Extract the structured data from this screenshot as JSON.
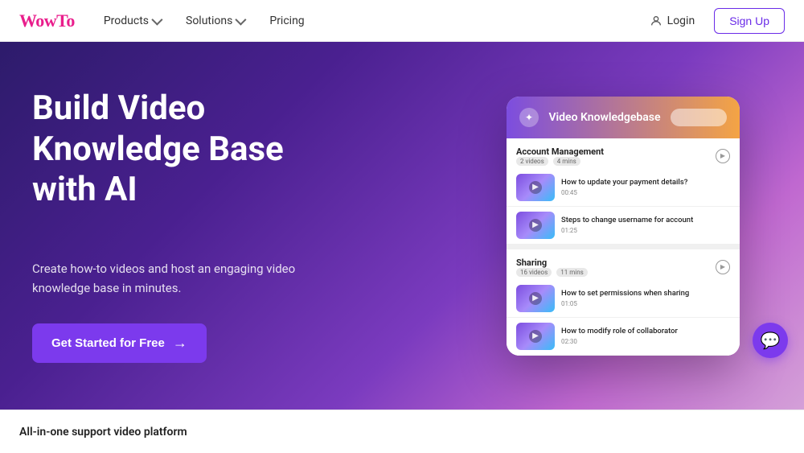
{
  "brand": {
    "logo": "WowTo",
    "logo_color": "#e91e8c"
  },
  "navbar": {
    "links": [
      {
        "label": "Products",
        "has_dropdown": true
      },
      {
        "label": "Solutions",
        "has_dropdown": true
      },
      {
        "label": "Pricing",
        "has_dropdown": false
      }
    ],
    "login_label": "Login",
    "signup_label": "Sign Up"
  },
  "hero": {
    "title": "Build Video Knowledge Base with AI",
    "subtitle": "Create how-to videos and host an engaging video knowledge base in minutes.",
    "cta_label": "Get Started for Free",
    "cta_arrow": "→"
  },
  "mockup": {
    "header_icon": "✦",
    "title": "Video Knowledgebase",
    "sections": [
      {
        "name": "Account Management",
        "badge1": "2 videos",
        "badge2": "4 mins",
        "videos": [
          {
            "title": "How to update your payment details?",
            "duration": "00:45"
          },
          {
            "title": "Steps to change username for account",
            "duration": "01:25"
          }
        ]
      },
      {
        "name": "Sharing",
        "badge1": "16 videos",
        "badge2": "11 mins",
        "videos": [
          {
            "title": "How to set permissions when sharing",
            "duration": "01:05"
          },
          {
            "title": "How to modify role of collaborator",
            "duration": "02:30"
          }
        ]
      }
    ]
  },
  "bottom": {
    "label": "All-in-one support video platform"
  },
  "chat": {
    "icon": "💬"
  }
}
